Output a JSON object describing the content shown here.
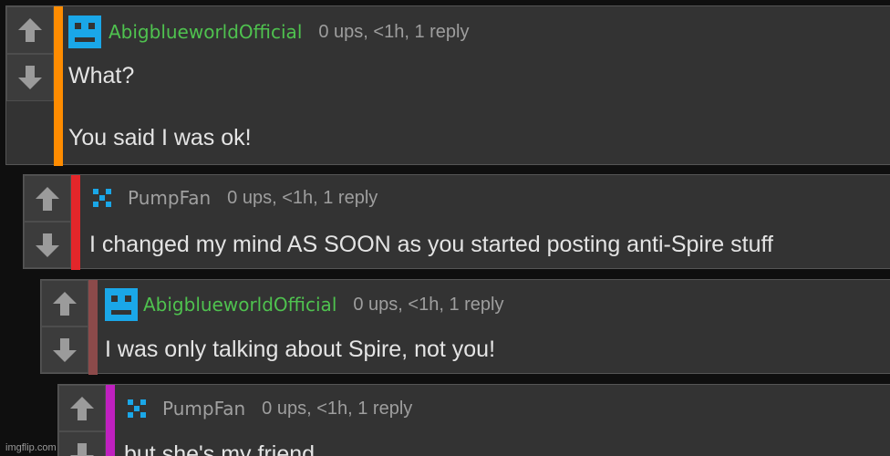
{
  "colors": {
    "accent_orange": "#ff8c00",
    "accent_red": "#e3262a",
    "accent_maroon": "#8c4a4a",
    "accent_magenta": "#c020c0",
    "username_green": "#4fc24f",
    "username_gray": "#a0a0a0",
    "avatar_blue": "#1aa7e8"
  },
  "icons": {
    "upvote": "arrow-up-icon",
    "downvote": "arrow-down-icon",
    "avatar_robot": "robot-face-icon",
    "avatar_pixel": "pixel-cross-icon"
  },
  "comments": [
    {
      "username": "AbigblueworldOfficial",
      "meta": "0 ups, <1h, 1 reply",
      "lines": [
        "What?",
        "You said I was ok!"
      ]
    },
    {
      "username": "PumpFan",
      "meta": "0 ups, <1h, 1 reply",
      "lines": [
        "I changed my mind AS SOON as you started posting anti-Spire stuff"
      ]
    },
    {
      "username": "AbigblueworldOfficial",
      "meta": "0 ups, <1h, 1 reply",
      "lines": [
        "I was only talking about Spire, not you!"
      ]
    },
    {
      "username": "PumpFan",
      "meta": "0 ups, <1h, 1 reply",
      "lines": [
        "but she's my friend"
      ]
    }
  ],
  "watermark": "imgflip.com"
}
